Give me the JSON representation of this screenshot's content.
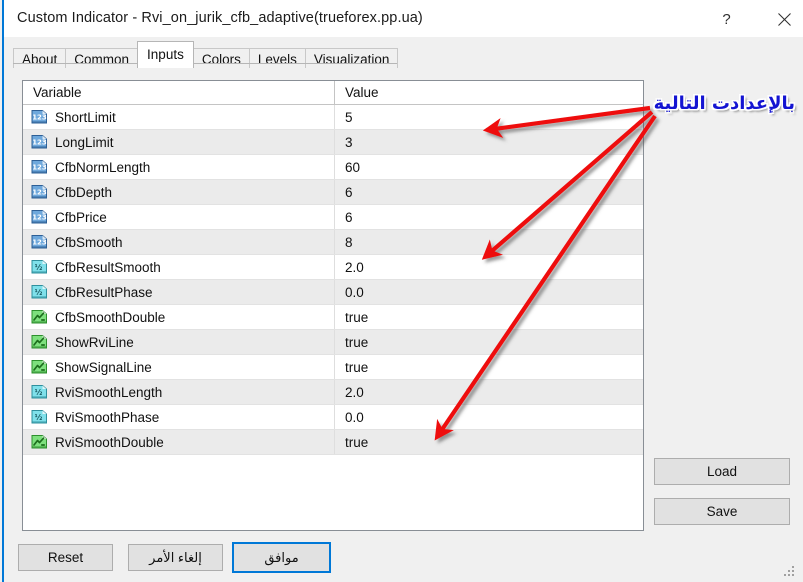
{
  "window": {
    "title": "Custom Indicator - Rvi_on_jurik_cfb_adaptive(trueforex.pp.ua)",
    "help_label": "?",
    "close_label": "×"
  },
  "tabs": [
    {
      "label": "About",
      "active": false
    },
    {
      "label": "Common",
      "active": false
    },
    {
      "label": "Inputs",
      "active": true
    },
    {
      "label": "Colors",
      "active": false
    },
    {
      "label": "Levels",
      "active": false
    },
    {
      "label": "Visualization",
      "active": false
    }
  ],
  "table": {
    "headers": {
      "variable": "Variable",
      "value": "Value"
    },
    "rows": [
      {
        "icon": "integer-type-icon",
        "name": "ShortLimit",
        "value": "5"
      },
      {
        "icon": "integer-type-icon",
        "name": "LongLimit",
        "value": "3"
      },
      {
        "icon": "integer-type-icon",
        "name": "CfbNormLength",
        "value": "60"
      },
      {
        "icon": "integer-type-icon",
        "name": "CfbDepth",
        "value": "6"
      },
      {
        "icon": "integer-type-icon",
        "name": "CfbPrice",
        "value": "6"
      },
      {
        "icon": "integer-type-icon",
        "name": "CfbSmooth",
        "value": "8"
      },
      {
        "icon": "double-type-icon",
        "name": "CfbResultSmooth",
        "value": "2.0"
      },
      {
        "icon": "double-type-icon",
        "name": "CfbResultPhase",
        "value": "0.0"
      },
      {
        "icon": "boolean-type-icon",
        "name": "CfbSmoothDouble",
        "value": "true"
      },
      {
        "icon": "boolean-type-icon",
        "name": "ShowRviLine",
        "value": "true"
      },
      {
        "icon": "boolean-type-icon",
        "name": "ShowSignalLine",
        "value": "true"
      },
      {
        "icon": "double-type-icon",
        "name": "RviSmoothLength",
        "value": "2.0"
      },
      {
        "icon": "double-type-icon",
        "name": "RviSmoothPhase",
        "value": "0.0"
      },
      {
        "icon": "boolean-type-icon",
        "name": "RviSmoothDouble",
        "value": "true"
      }
    ]
  },
  "side_buttons": {
    "load": "Load",
    "save": "Save"
  },
  "footer": {
    "reset": "Reset",
    "cancel": "إلغاء الأمر",
    "ok": "موافق"
  },
  "annotation": {
    "text": "بالإعدادت التالية",
    "color": "#1414d2",
    "arrow_color": "#ee1111",
    "arrows": 3
  },
  "colors": {
    "accent": "#0078d7",
    "titlebar_bg": "#ffffff",
    "panel_bg": "#f0f0f0",
    "row_alt_bg": "#ebebeb",
    "integer_icon": "#4a8fd4",
    "double_icon": "#5fd3e0",
    "boolean_icon": "#55cc55"
  }
}
